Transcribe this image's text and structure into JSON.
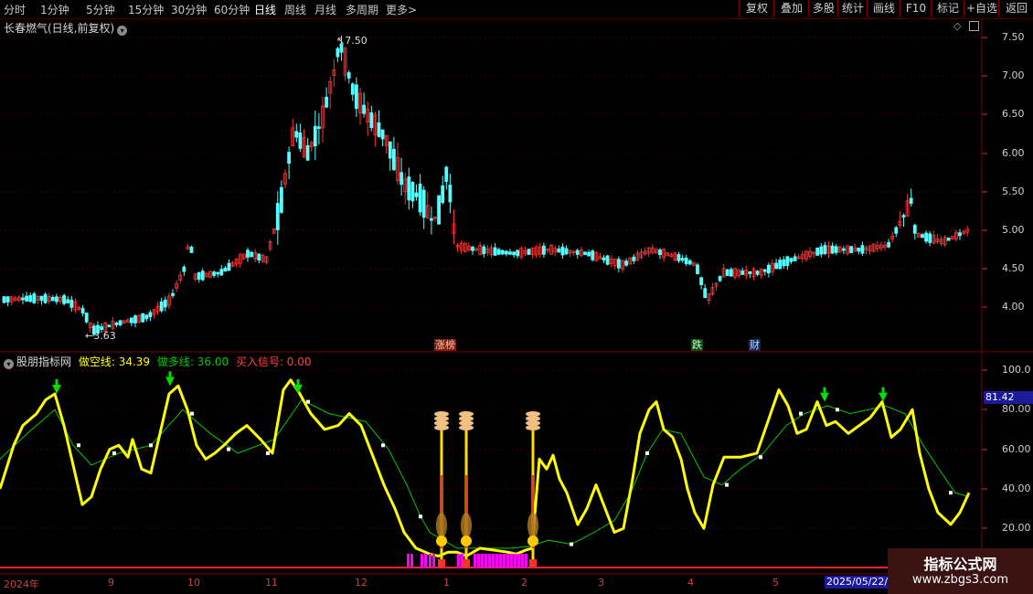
{
  "periods": [
    {
      "label": "分时",
      "active": false
    },
    {
      "label": "1分钟",
      "active": false
    },
    {
      "label": "5分钟",
      "active": false
    },
    {
      "label": "15分钟",
      "active": false
    },
    {
      "label": "30分钟",
      "active": false
    },
    {
      "label": "60分钟",
      "active": false
    },
    {
      "label": "日线",
      "active": true
    },
    {
      "label": "周线",
      "active": false
    },
    {
      "label": "月线",
      "active": false
    },
    {
      "label": "多周期",
      "active": false
    },
    {
      "label": "更多",
      "active": false
    }
  ],
  "more_arrow": ">",
  "toolbar_right": [
    "复权",
    "叠加",
    "多股",
    "统计",
    "画线",
    "F10",
    "标记",
    "+自选",
    "返回"
  ],
  "main_chart": {
    "title": "长春燃气(日线,前复权)",
    "y_ticks": [
      "7.50",
      "7.00",
      "6.50",
      "6.00",
      "5.50",
      "5.00",
      "4.50",
      "4.00"
    ],
    "high_label": "7.50",
    "low_label": "3.63",
    "badges": [
      "涨榜",
      "跌",
      "财"
    ]
  },
  "indicator": {
    "name": "股朋指标网",
    "short_line_label": "做空线: 34.39",
    "long_line_label": "做多线: 36.00",
    "buy_signal_label": "买入信号: 0.00",
    "y_ticks": [
      "100.0",
      "80.00",
      "60.00",
      "40.00",
      "20.00"
    ],
    "current_value": "81.42"
  },
  "x_axis": [
    "2024年",
    "9",
    "10",
    "11",
    "12",
    "1",
    "2",
    "3",
    "4",
    "5"
  ],
  "date_box": "2025/05/22/四",
  "watermark": {
    "line1": "指标公式网",
    "line2": "www.zbgs3.com"
  },
  "colors": {
    "up": "#ff3232",
    "down": "#54ffff",
    "grid": "#7a0000",
    "short_line": "#ffff00",
    "long_line": "#00cc00",
    "buy": "#ff00ff"
  }
}
